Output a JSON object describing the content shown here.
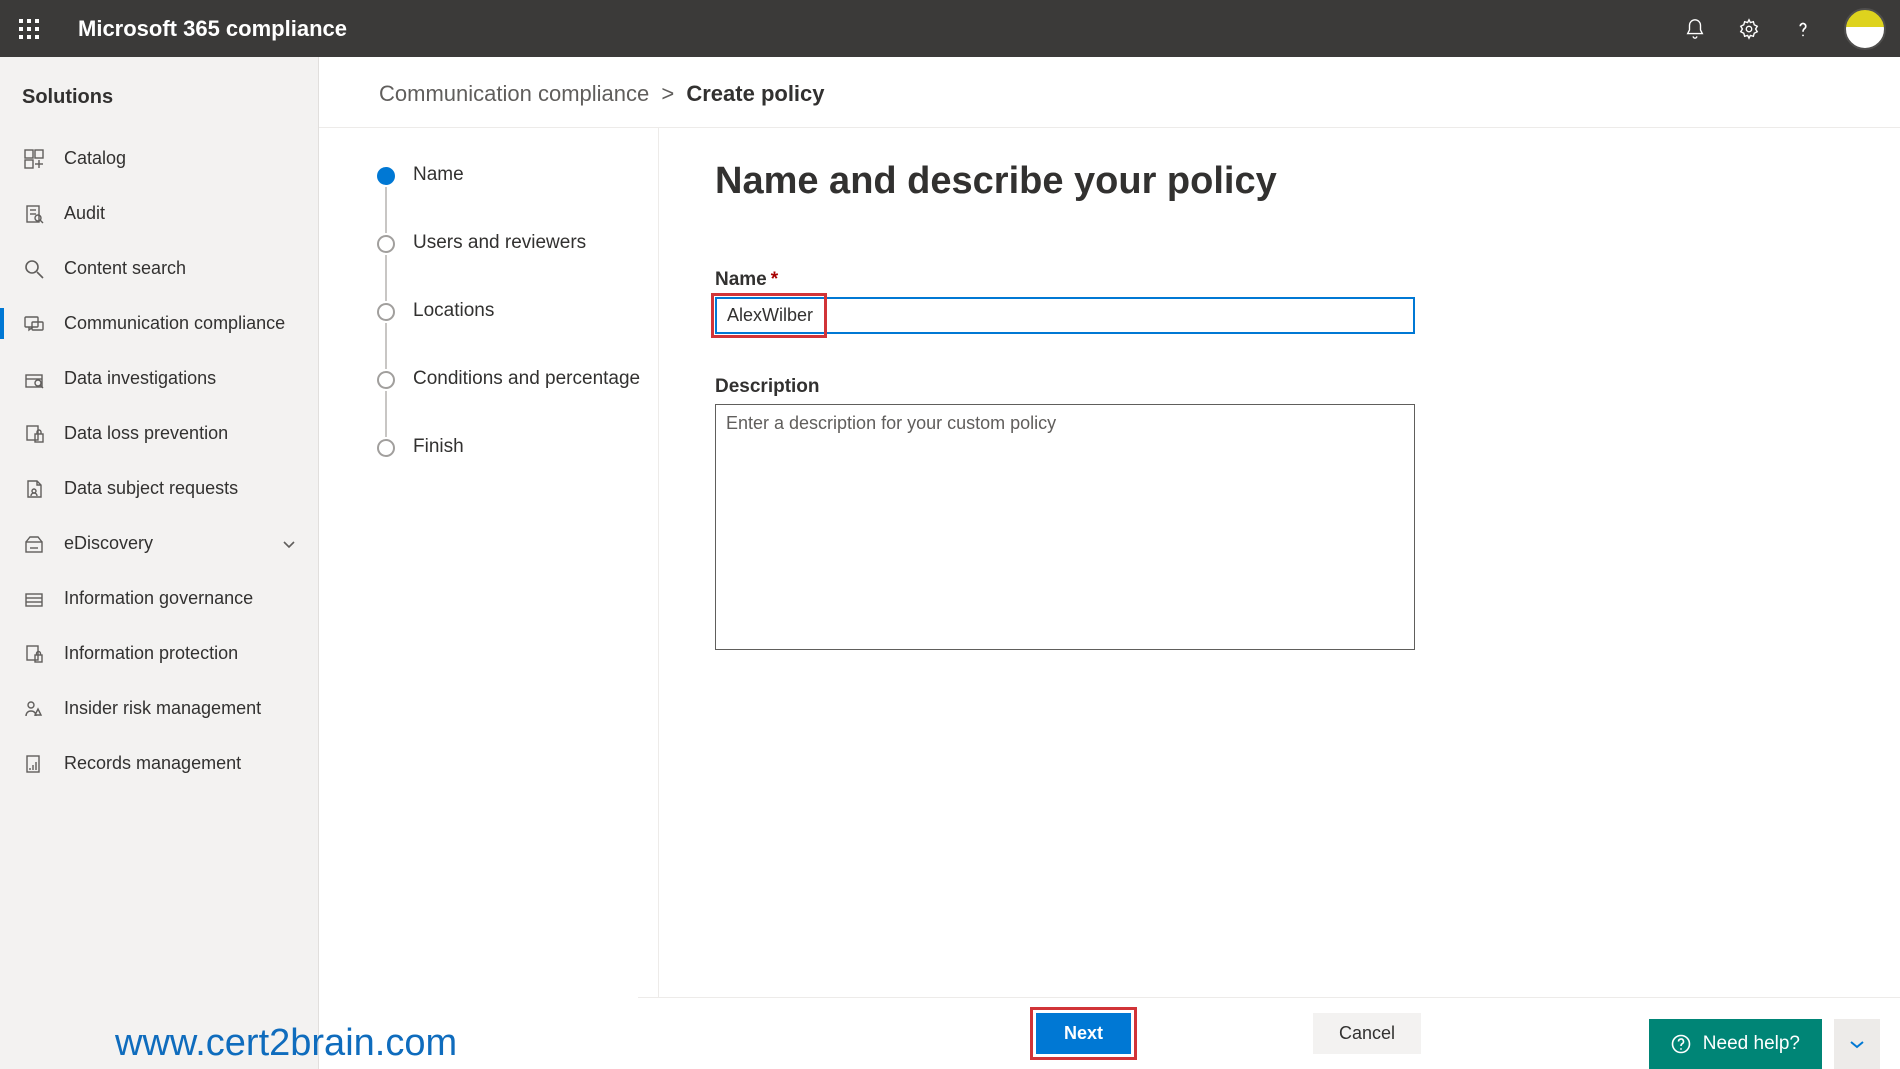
{
  "header": {
    "app_title": "Microsoft 365 compliance"
  },
  "sidebar": {
    "heading": "Solutions",
    "items": [
      {
        "label": "Catalog"
      },
      {
        "label": "Audit"
      },
      {
        "label": "Content search"
      },
      {
        "label": "Communication compliance",
        "selected": true
      },
      {
        "label": "Data investigations"
      },
      {
        "label": "Data loss prevention"
      },
      {
        "label": "Data subject requests"
      },
      {
        "label": "eDiscovery",
        "expandable": true
      },
      {
        "label": "Information governance"
      },
      {
        "label": "Information protection"
      },
      {
        "label": "Insider risk management"
      },
      {
        "label": "Records management"
      }
    ]
  },
  "breadcrumb": {
    "parent": "Communication compliance",
    "separator": ">",
    "current": "Create policy"
  },
  "wizard": {
    "steps": [
      {
        "label": "Name",
        "active": true
      },
      {
        "label": "Users and reviewers"
      },
      {
        "label": "Locations"
      },
      {
        "label": "Conditions and percentage"
      },
      {
        "label": "Finish"
      }
    ]
  },
  "form": {
    "heading": "Name and describe your policy",
    "name_label": "Name",
    "name_value": "AlexWilber",
    "description_label": "Description",
    "description_placeholder": "Enter a description for your custom policy"
  },
  "footer": {
    "next": "Next",
    "cancel": "Cancel",
    "need_help": "Need help?"
  },
  "watermark": "www.cert2brain.com"
}
